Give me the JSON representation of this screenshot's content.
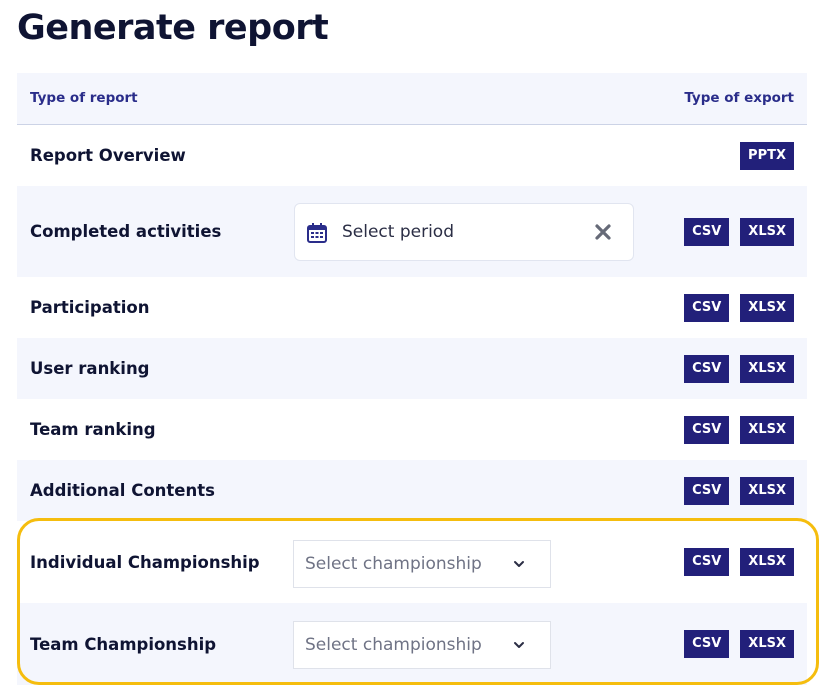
{
  "page": {
    "title": "Generate report"
  },
  "header": {
    "type_of_report": "Type of report",
    "type_of_export": "Type of export"
  },
  "rows": [
    {
      "label": "Report Overview",
      "exports": [
        "PPTX"
      ]
    },
    {
      "label": "Completed activities",
      "exports": [
        "CSV",
        "XLSX"
      ],
      "period": {
        "placeholder": "Select period"
      }
    },
    {
      "label": "Participation",
      "exports": [
        "CSV",
        "XLSX"
      ]
    },
    {
      "label": "User ranking",
      "exports": [
        "CSV",
        "XLSX"
      ]
    },
    {
      "label": "Team ranking",
      "exports": [
        "CSV",
        "XLSX"
      ]
    },
    {
      "label": "Additional Contents",
      "exports": [
        "CSV",
        "XLSX"
      ]
    },
    {
      "label": "Individual Championship",
      "exports": [
        "CSV",
        "XLSX"
      ],
      "select": {
        "placeholder": "Select championship"
      }
    },
    {
      "label": "Team Championship",
      "exports": [
        "CSV",
        "XLSX"
      ],
      "select": {
        "placeholder": "Select championship"
      }
    }
  ],
  "colors": {
    "badge": "#22207a",
    "highlight": "#f5bd0e",
    "row_alt": "#f4f6fd"
  },
  "icons": {
    "calendar": "calendar-icon",
    "clear": "close-icon",
    "chevron": "chevron-down-icon"
  }
}
